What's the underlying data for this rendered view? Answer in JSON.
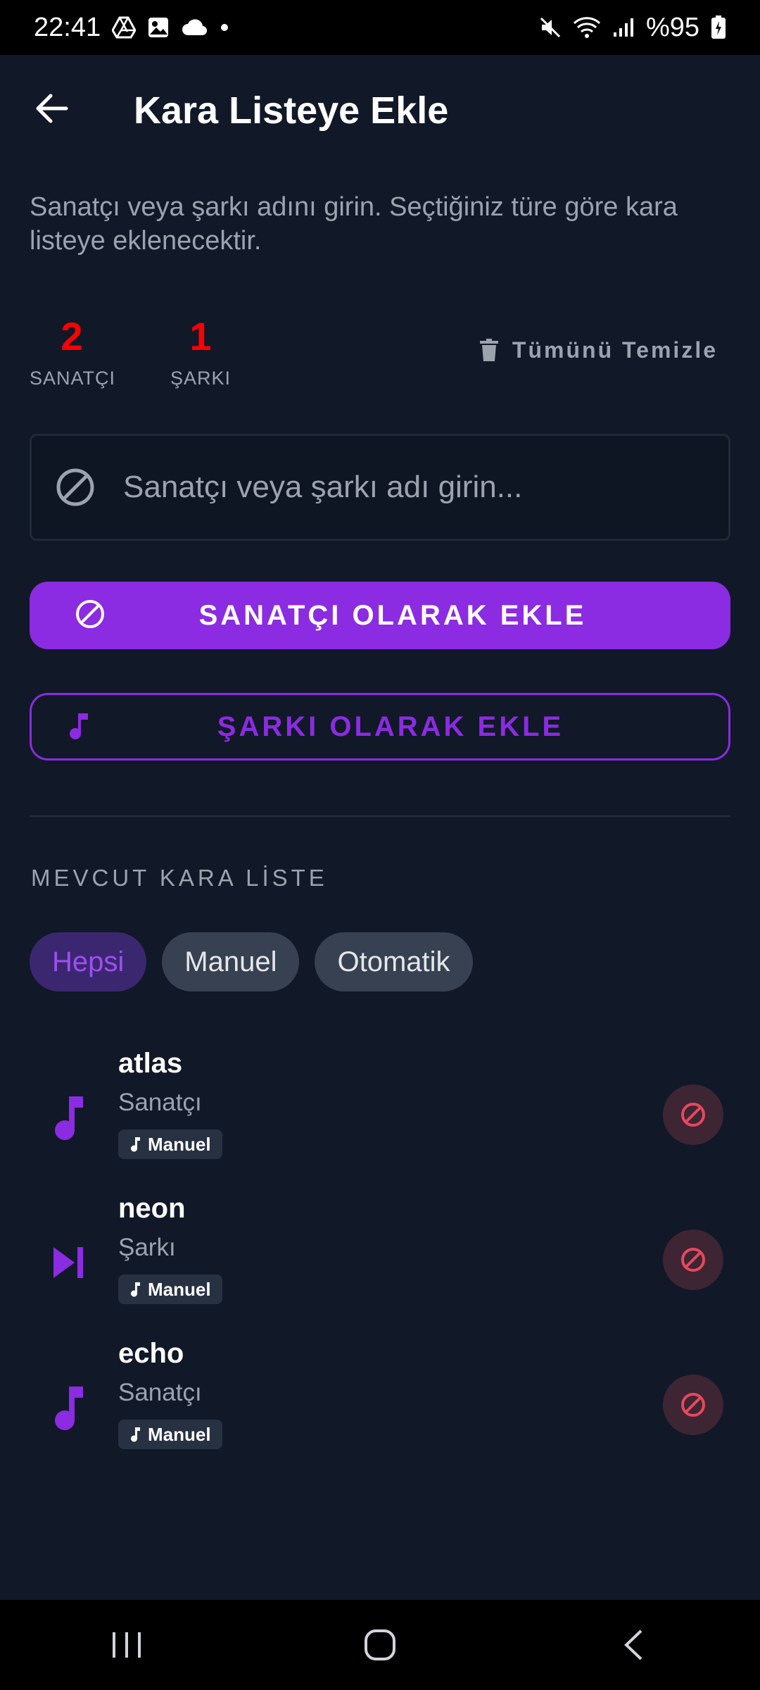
{
  "status_bar": {
    "time": "22:41",
    "battery": "%95",
    "icons_left": [
      "drive-icon",
      "gallery-icon",
      "cloud-icon",
      "dot-icon"
    ],
    "icons_right": [
      "mute-icon",
      "wifi-icon",
      "signal-icon",
      "battery-icon"
    ]
  },
  "header": {
    "title": "Kara Listeye Ekle",
    "back_icon": "arrow-left-icon"
  },
  "description": "Sanatçı veya şarkı adını girin. Seçtiğiniz türe göre kara listeye eklenecektir.",
  "stats": {
    "artist_count": "2",
    "artist_label": "SANATÇI",
    "song_count": "1",
    "song_label": "ŞARKI",
    "clear_label": "Tümünü Temizle"
  },
  "search": {
    "placeholder": "Sanatçı veya şarkı adı girin...",
    "value": ""
  },
  "buttons": {
    "add_artist": "SANATÇI OLARAK EKLE",
    "add_song": "ŞARKI OLARAK EKLE"
  },
  "section_title": "MEVCUT KARA LİSTE",
  "filters": [
    {
      "label": "Hepsi",
      "active": true
    },
    {
      "label": "Manuel",
      "active": false
    },
    {
      "label": "Otomatik",
      "active": false
    }
  ],
  "items": [
    {
      "title": "atlas",
      "subtitle": "Sanatçı",
      "badge": "Manuel",
      "icon": "music-note-icon"
    },
    {
      "title": "neon",
      "subtitle": "Şarkı",
      "badge": "Manuel",
      "icon": "skip-next-icon"
    },
    {
      "title": "echo",
      "subtitle": "Sanatçı",
      "badge": "Manuel",
      "icon": "music-note-icon"
    }
  ],
  "colors": {
    "background": "#111827",
    "accent": "#8b2be2",
    "count": "#ff0000",
    "remove": "#e5485f"
  }
}
